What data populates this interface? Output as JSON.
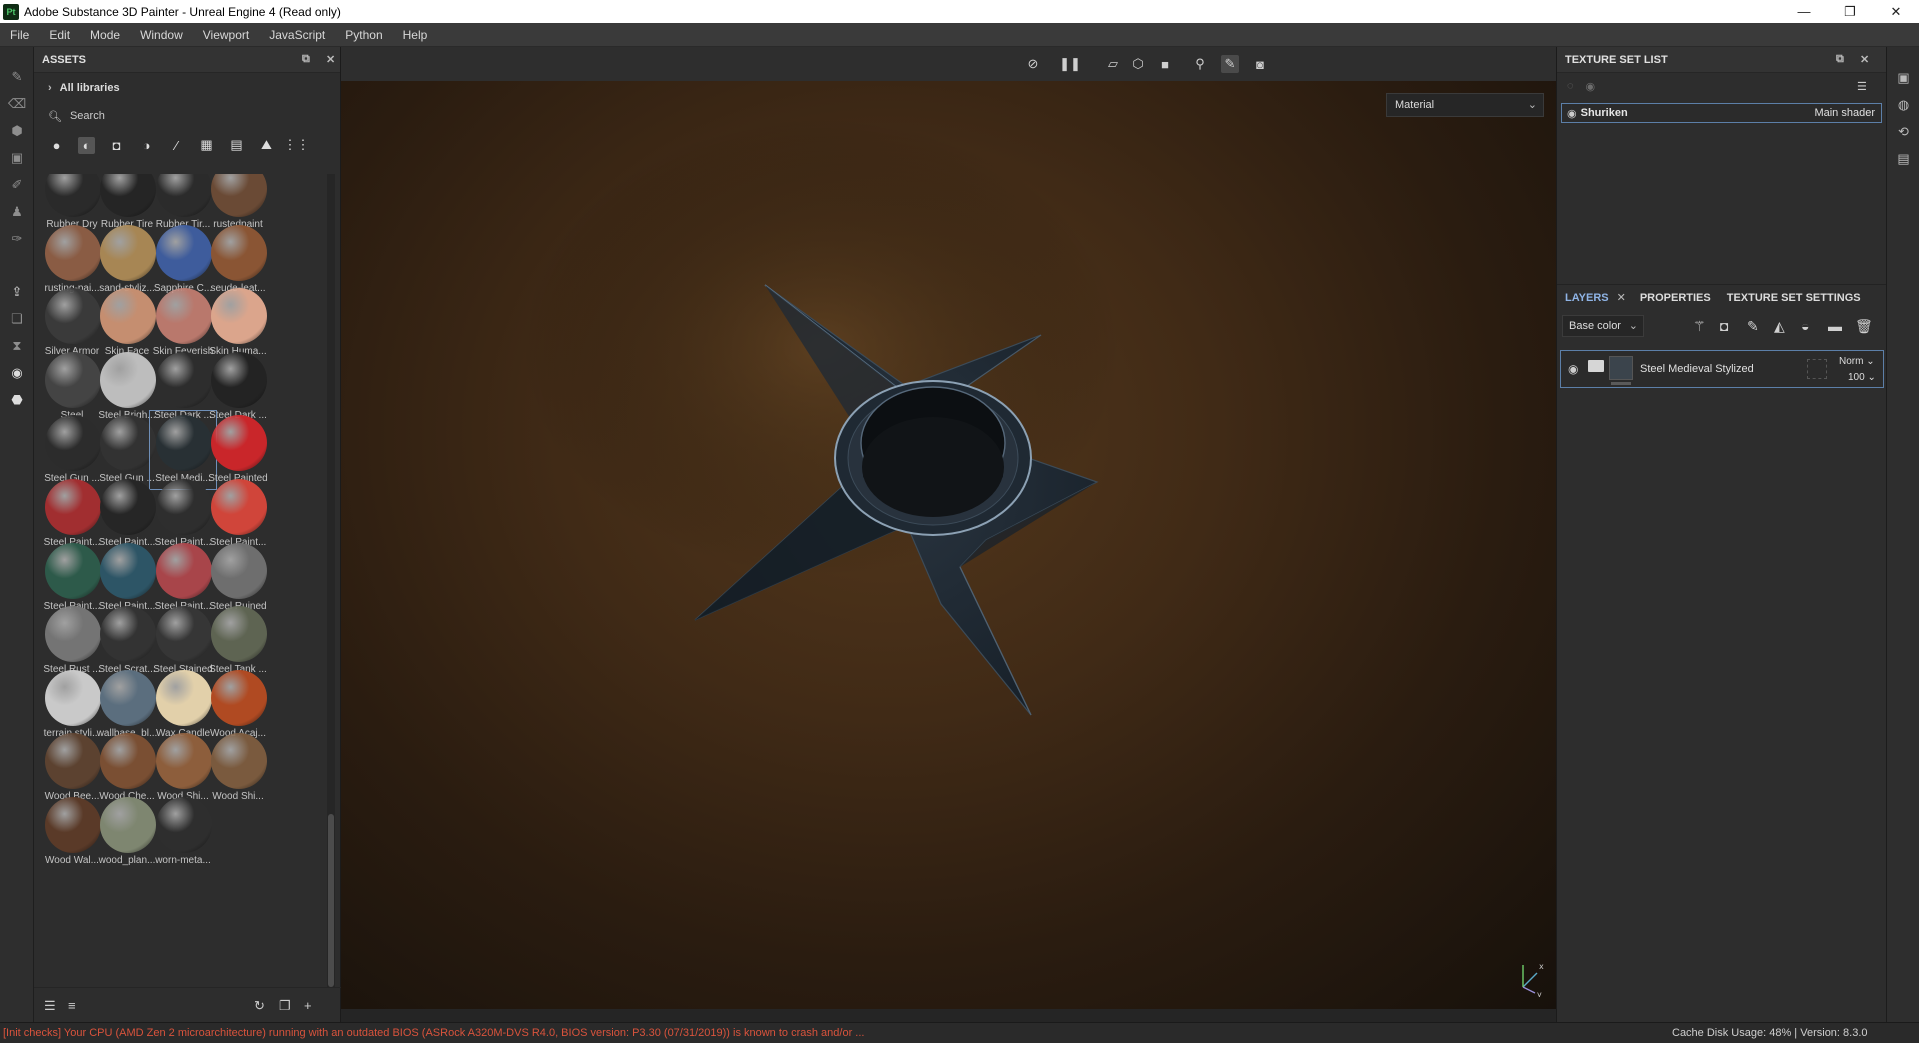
{
  "window": {
    "logo": "Pt",
    "title": "Adobe Substance 3D Painter - Unreal Engine 4 (Read only)",
    "minimize": "—",
    "maximize": "❐",
    "close": "✕"
  },
  "menu": [
    "File",
    "Edit",
    "Mode",
    "Window",
    "Viewport",
    "JavaScript",
    "Python",
    "Help"
  ],
  "assets": {
    "title": "ASSETS",
    "libraries": "All libraries",
    "search_placeholder": "Search",
    "materials": [
      {
        "label": "Rubber Dry",
        "color": "#2a2a2a"
      },
      {
        "label": "Rubber Tire",
        "color": "#252525"
      },
      {
        "label": "Rubber Tir...",
        "color": "#2b2b2b"
      },
      {
        "label": "rustedpaint",
        "color": "#6a4a35"
      },
      {
        "label": "rusting-pai...",
        "color": "#8a5c44"
      },
      {
        "label": "sand-styliz...",
        "color": "#a78654"
      },
      {
        "label": "Sapphire C...",
        "color": "#3e5c9c"
      },
      {
        "label": "seude-leat...",
        "color": "#8a5534"
      },
      {
        "label": "Silver Armor",
        "color": "#3a3a3a"
      },
      {
        "label": "Skin Face",
        "color": "#c58e70"
      },
      {
        "label": "Skin Feverish",
        "color": "#b9786c"
      },
      {
        "label": "Skin Huma...",
        "color": "#dba58c"
      },
      {
        "label": "Steel",
        "color": "#444444"
      },
      {
        "label": "Steel Brigh...",
        "color": "#bdbdbd"
      },
      {
        "label": "Steel Dark ...",
        "color": "#2d2d2d"
      },
      {
        "label": "Steel Dark ...",
        "color": "#232323"
      },
      {
        "label": "Steel Gun ...",
        "color": "#2c2c2c"
      },
      {
        "label": "Steel Gun ...",
        "color": "#323232"
      },
      {
        "label": "Steel Medi...",
        "color": "#283034"
      },
      {
        "label": "Steel Painted",
        "color": "#c9262a"
      },
      {
        "label": "Steel Paint...",
        "color": "#a12e30"
      },
      {
        "label": "Steel Paint...",
        "color": "#262626"
      },
      {
        "label": "Steel Paint...",
        "color": "#2e2e2e"
      },
      {
        "label": "Steel Paint...",
        "color": "#d0453a"
      },
      {
        "label": "Steel Paint...",
        "color": "#2d5a4a"
      },
      {
        "label": "Steel Paint...",
        "color": "#2d5566"
      },
      {
        "label": "Steel Paint...",
        "color": "#a8454a"
      },
      {
        "label": "Steel Ruined",
        "color": "#6e6e6e"
      },
      {
        "label": "Steel Rust ...",
        "color": "#747474"
      },
      {
        "label": "Steel Scrat...",
        "color": "#333333"
      },
      {
        "label": "Steel Stained",
        "color": "#363636"
      },
      {
        "label": "Steel Tank ...",
        "color": "#5e6452"
      },
      {
        "label": "terrain styli...",
        "color": "#c9c9c9"
      },
      {
        "label": "wallbase_bl...",
        "color": "#5b6e7e"
      },
      {
        "label": "Wax Candle",
        "color": "#e2d0aa"
      },
      {
        "label": "Wood Acaj...",
        "color": "#b04a22"
      },
      {
        "label": "Wood Bee...",
        "color": "#5c4230"
      },
      {
        "label": "Wood Che...",
        "color": "#7a4f33"
      },
      {
        "label": "Wood Shi...",
        "color": "#8d5e3c"
      },
      {
        "label": "Wood Shi...",
        "color": "#7a5a3e"
      },
      {
        "label": "Wood Wal...",
        "color": "#5a3a28"
      },
      {
        "label": "wood_plan...",
        "color": "#7e8670"
      },
      {
        "label": "worn-meta...",
        "color": "#2e2e2e"
      }
    ]
  },
  "viewport": {
    "material_mode": "Material",
    "axis_x": "x",
    "axis_y": "y"
  },
  "texture_set_list": {
    "title": "TEXTURE SET LIST",
    "set_name": "Shuriken",
    "shader": "Main shader"
  },
  "tabs": [
    "LAYERS",
    "PROPERTIES",
    "TEXTURE SET SETTINGS"
  ],
  "layers": {
    "channel": "Base color",
    "layer_name": "Steel Medieval Stylized",
    "blend": "Norm",
    "opacity": "100"
  },
  "status": {
    "message": "[Init checks] Your CPU (AMD Zen 2 microarchitecture) running with an outdated BIOS (ASRock A320M-DVS R4.0, BIOS version: P3.30 (07/31/2019)) is known to crash and/or ...",
    "cache_label": "Cache Disk Usage:",
    "cache_value": "48%",
    "version": "Version: 8.3.0"
  },
  "colors": {
    "accent": "#5c7fa8",
    "error_text": "#d9533c"
  }
}
